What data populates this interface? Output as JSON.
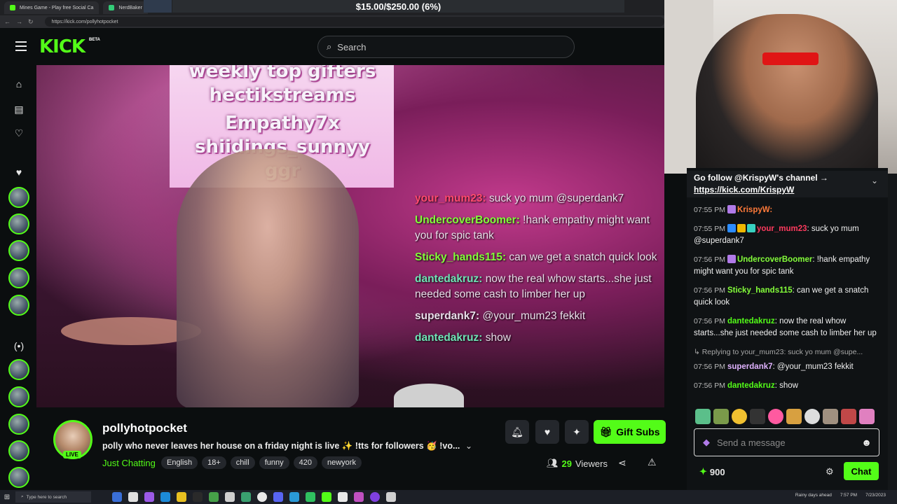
{
  "browser": {
    "tabs": [
      {
        "label": "Mines Game - Play free Social Ca"
      },
      {
        "label": "NerdBaker"
      }
    ],
    "url": "https://kick.com/pollyhotpocket",
    "overlay_banner": "$15.00/$250.00 (6%)"
  },
  "header": {
    "logo": "KICK",
    "beta": "BETA",
    "search_placeholder": "Search"
  },
  "sidebar": {
    "icons": [
      "home-icon",
      "following-icon",
      "heart-icon"
    ],
    "section_icon": "heart-icon",
    "code_icon": "(•)"
  },
  "video": {
    "overlay_lines": [
      "weekly top gifters",
      "hectikstreams",
      "Empathy7x",
      "shiidings_sunnyy",
      "ggr"
    ],
    "chat": [
      {
        "user": "your_mum23:",
        "text": " suck yo mum @superdank7",
        "color": "#ff4a6e"
      },
      {
        "user": "UndercoverBoomer:",
        "text": " !hank empathy might want you for spic tank",
        "color": "#84ff3a"
      },
      {
        "user": "Sticky_hands115:",
        "text": " can we get a snatch quick look",
        "color": "#84ff3a"
      },
      {
        "user": "dantedakruz:",
        "text": " now the real whow starts...she just needed some cash to limber her up",
        "color": "#6fe4b6"
      },
      {
        "user": "superdank7:",
        "text": " @your_mum23 fekkit",
        "color": "#e9dde9"
      },
      {
        "user": "dantedakruz:",
        "text": " show",
        "color": "#6fe4b6"
      }
    ]
  },
  "stream": {
    "name": "pollyhotpocket",
    "live": "LIVE",
    "title": "polly who never leaves her house on a friday night is live ✨ !tts for followers 🥳 !vo...",
    "category": "Just Chatting",
    "tags": [
      "English",
      "18+",
      "chill",
      "funny",
      "420",
      "newyork"
    ],
    "viewers_count": "29",
    "viewers_label": "Viewers",
    "gift_label": "Gift Subs"
  },
  "chat": {
    "pinned_line1": "Go follow @KrispyW's channel →",
    "pinned_link": "https://kick.com/KrispyW",
    "messages": [
      {
        "time": "07:55 PM",
        "user": "KrispyW:",
        "text": "",
        "color": "#ff7a3a",
        "badge": "#b07ae8"
      },
      {
        "time": "07:55 PM",
        "user": "your_mum23",
        "text": ": suck yo mum @superdank7",
        "color": "#ff3a5e",
        "badge": "#2b8cff"
      },
      {
        "time": "07:56 PM",
        "user": "UndercoverBoomer",
        "text": ": !hank empathy might want you for spic tank",
        "color": "#84ff3a",
        "badge": "#b07ae8"
      },
      {
        "time": "07:56 PM",
        "user": "Sticky_hands115",
        "text": ": can we get a snatch quick look",
        "color": "#84ff3a",
        "badge": ""
      },
      {
        "time": "07:56 PM",
        "user": "dantedakruz",
        "text": ": now the real whow starts...she just needed some cash to limber her up",
        "color": "#53fc18",
        "badge": ""
      }
    ],
    "reply_to": "↳ Replying to your_mum23: suck yo mum @supe...",
    "reply_msg": {
      "time": "07:56 PM",
      "user": "superdank7",
      "text": ": @your_mum23 fekkit",
      "color": "#e0b3ff"
    },
    "last_msg": {
      "time": "07:56 PM",
      "user": "dantedakruz",
      "text": ": show",
      "color": "#53fc18"
    },
    "input_placeholder": "Send a message",
    "points": "900",
    "send_label": "Chat"
  },
  "taskbar": {
    "search_placeholder": "Type here to search",
    "weather": "Rainy days ahead",
    "time": "7:57 PM",
    "date": "7/23/2023"
  },
  "colors": {
    "accent": "#53fc18",
    "bg": "#0b0e0f"
  }
}
